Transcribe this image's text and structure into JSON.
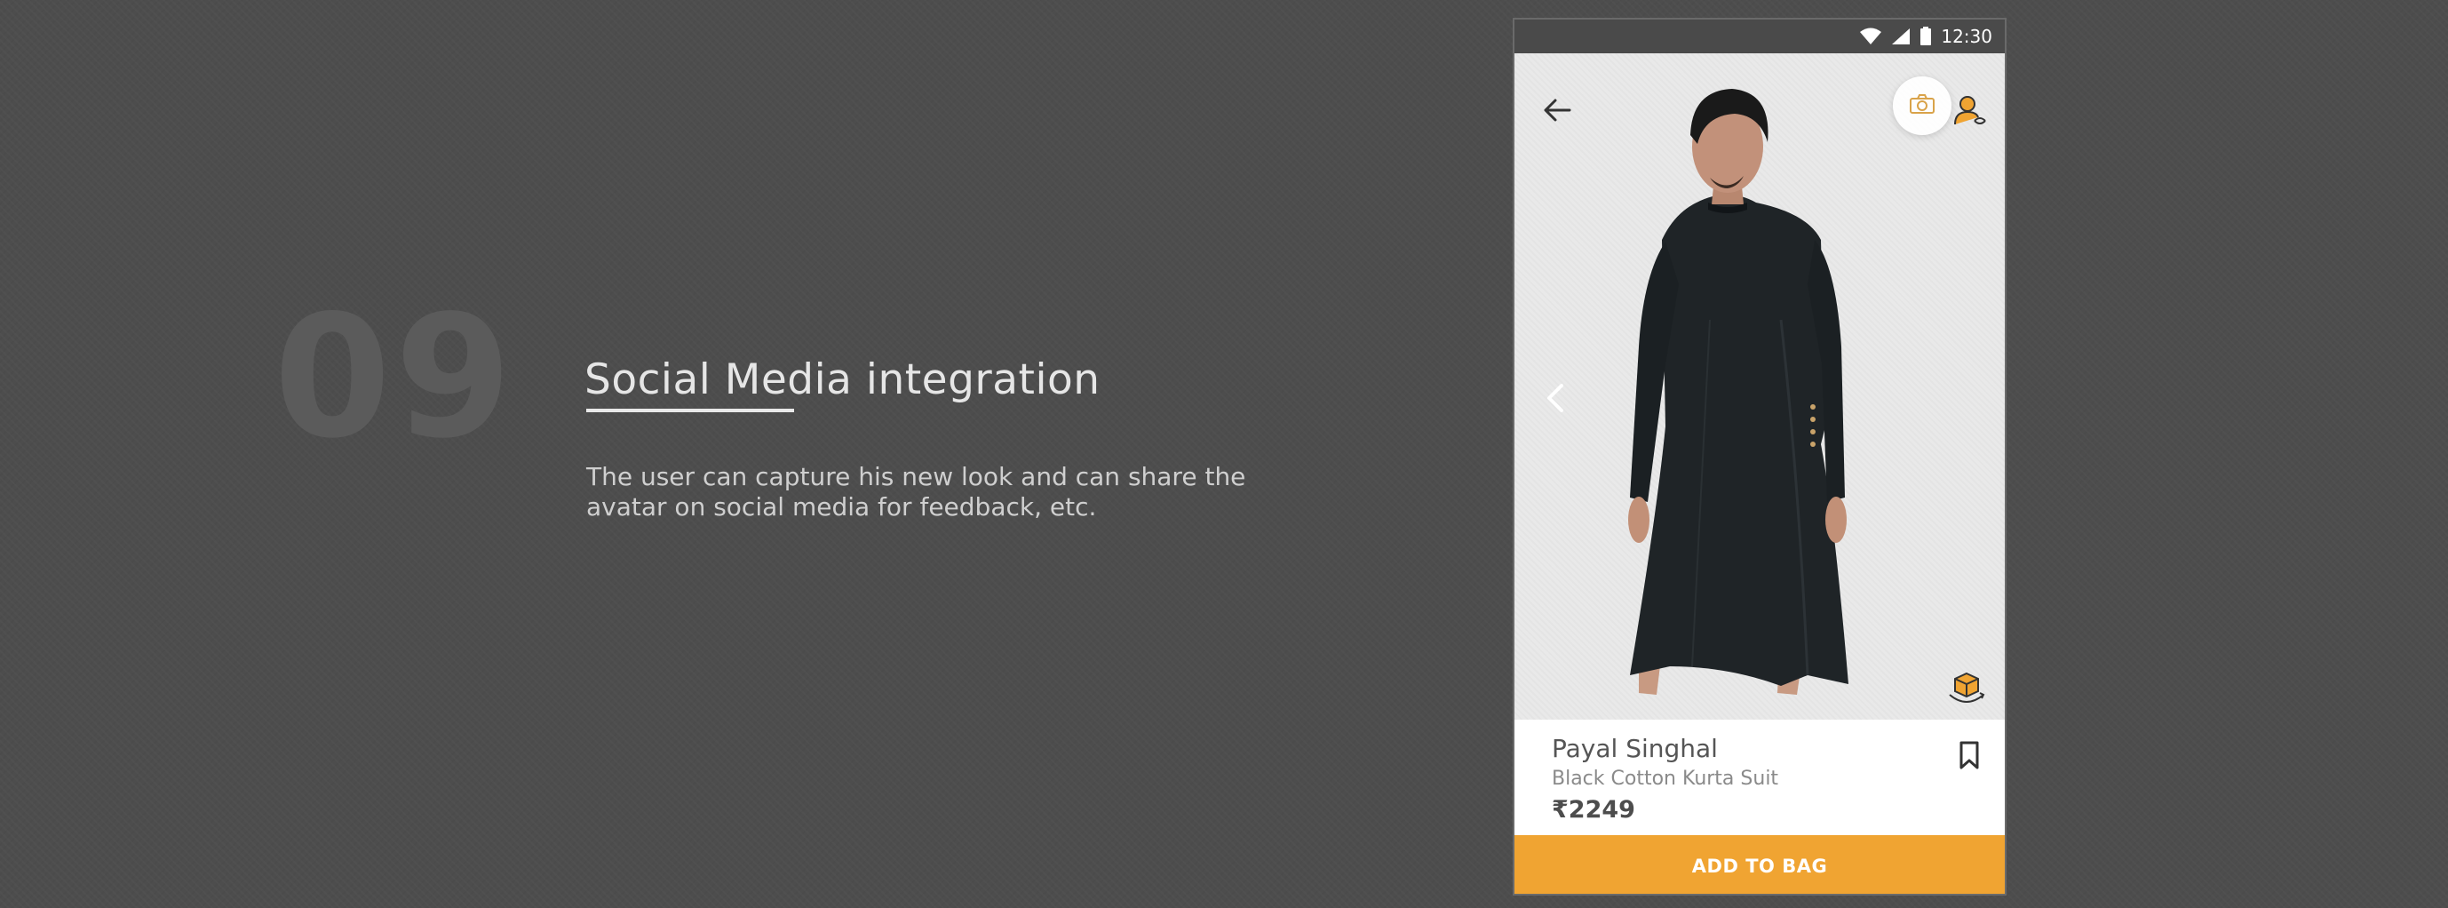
{
  "slide": {
    "number": "09",
    "title": "Social Media integration",
    "description": "The user can capture his new look and can share the avatar on social media for feedback, etc."
  },
  "status_bar": {
    "time": "12:30",
    "icons": [
      "wifi-icon",
      "signal-icon",
      "battery-icon"
    ]
  },
  "viewer": {
    "icons": [
      "back-arrow-icon",
      "camera-icon",
      "avatar-switch-icon",
      "chevron-left-icon",
      "rotate-3d-icon"
    ]
  },
  "product": {
    "brand": "Payal Singhal",
    "name": "Black Cotton Kurta Suit",
    "price": "₹2249"
  },
  "cta": {
    "add_to_bag": "ADD TO BAG"
  },
  "colors": {
    "background": "#4d4d4d",
    "accent": "#f0a432",
    "garment": "#1f2427"
  }
}
